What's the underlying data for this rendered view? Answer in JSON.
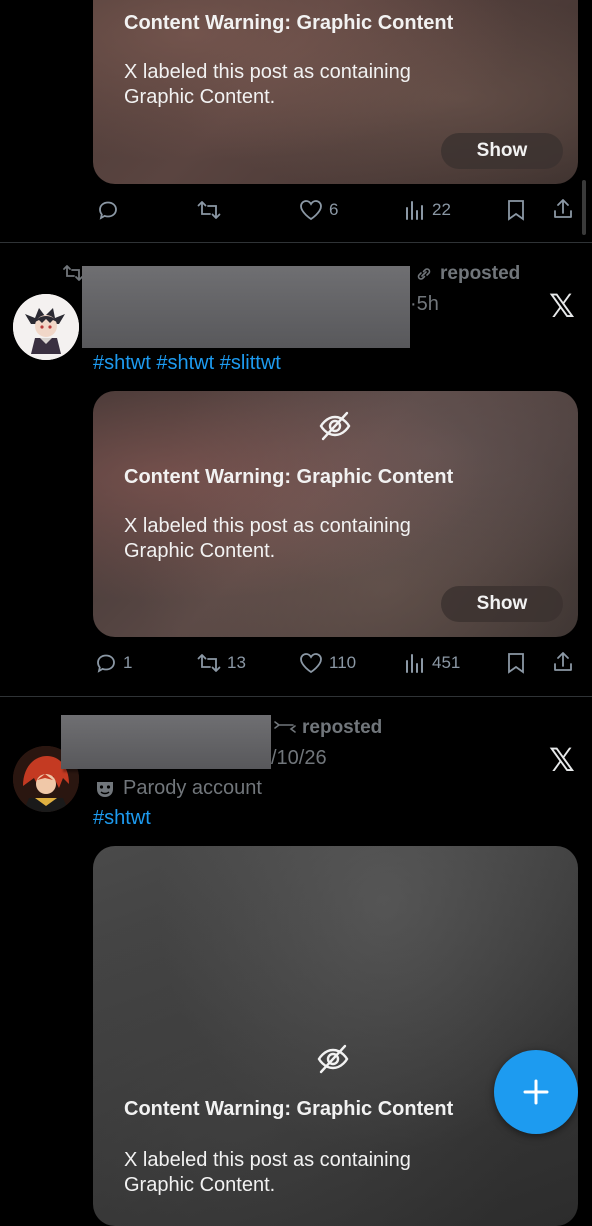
{
  "posts": [
    {
      "warning": {
        "title": "Content Warning: Graphic Content",
        "description": "X labeled this post as containing Graphic Content.",
        "show_label": "Show"
      },
      "actions": {
        "replies": "",
        "reposts": "",
        "likes": "6",
        "views": "22"
      }
    },
    {
      "repost_text": "reposted",
      "time": "·5h",
      "hashtags": "#shtwt #shtwt #slittwt",
      "warning": {
        "title": "Content Warning: Graphic Content",
        "description": "X labeled this post as containing Graphic Content.",
        "show_label": "Show"
      },
      "actions": {
        "replies": "1",
        "reposts": "13",
        "likes": "110",
        "views": "451"
      }
    },
    {
      "repost_text": "reposted",
      "time": "/10/26",
      "badge": "Parody account",
      "hashtags": "#shtwt",
      "warning": {
        "title": "Content Warning: Graphic Content",
        "description": "X labeled this post as containing Graphic Content."
      }
    }
  ],
  "fab_label": "+",
  "x_logo": "𝕏",
  "colors": {
    "accent": "#1d9bf0",
    "background": "#000000",
    "muted": "#71767b"
  }
}
